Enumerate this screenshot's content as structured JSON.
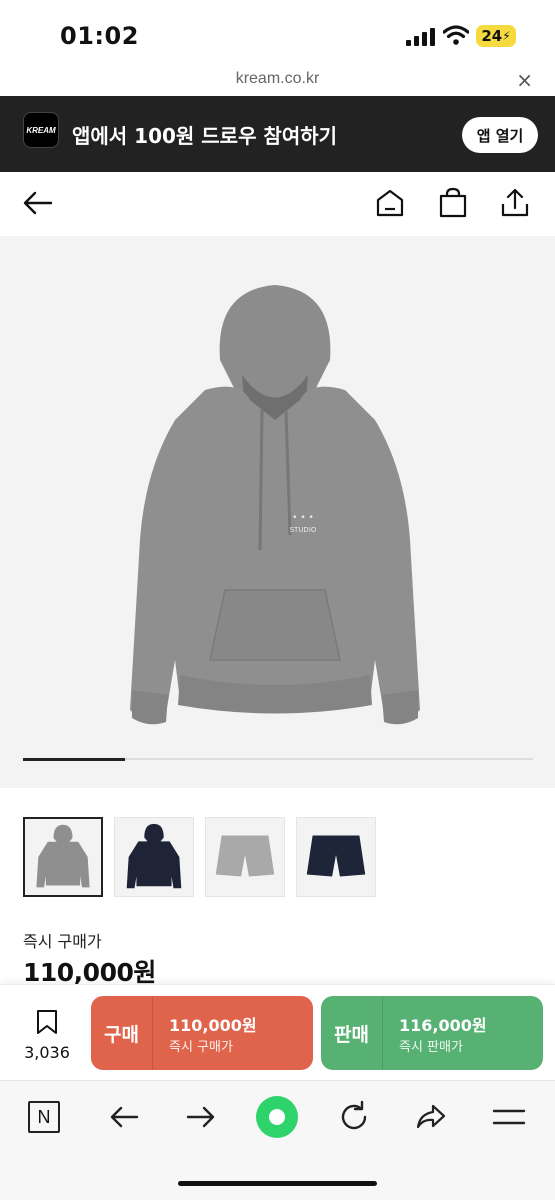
{
  "status": {
    "time": "01:02",
    "battery": "24"
  },
  "browser": {
    "url": "kream.co.kr",
    "close_symbol": "×"
  },
  "promo": {
    "logo_text": "KREAM",
    "text": "앱에서 100원 드로우 참여하기",
    "button": "앱 열기"
  },
  "product": {
    "image_progress_fraction": 0.2,
    "thumbnails": [
      {
        "desc": "gray hoodie",
        "color": "#8f8f8f",
        "selected": true
      },
      {
        "desc": "navy hoodie",
        "color": "#1e2435",
        "selected": false
      },
      {
        "desc": "gray shorts",
        "color": "#a9a9a9",
        "selected": false
      },
      {
        "desc": "navy shorts",
        "color": "#1f2538",
        "selected": false
      }
    ],
    "price_label": "즉시 구매가",
    "price": "110,000원"
  },
  "actions": {
    "bookmark_count": "3,036",
    "buy": {
      "label": "구매",
      "amount": "110,000원",
      "sub": "즉시 구매가",
      "color": "#e0634c"
    },
    "sell": {
      "label": "판매",
      "amount": "116,000원",
      "sub": "즉시 판매가",
      "color": "#56b173"
    }
  },
  "toolbar": {
    "n_label": "N",
    "accent": "#2fd36b"
  }
}
